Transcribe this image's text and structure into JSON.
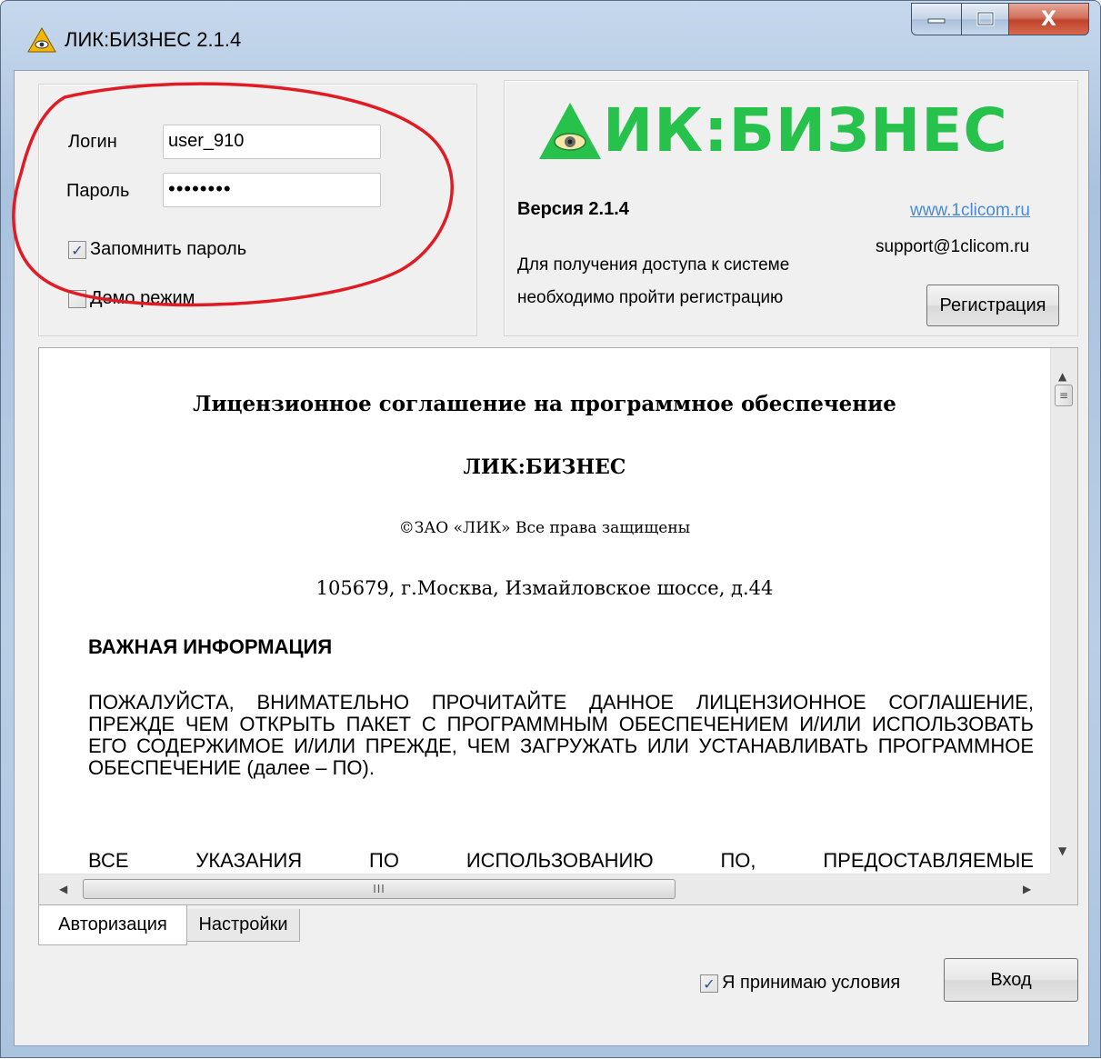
{
  "window": {
    "title": "ЛИК:БИЗНЕС 2.1.4",
    "buttons": {
      "minimize": "–",
      "maximize": "□",
      "close": "X"
    }
  },
  "login": {
    "login_label": "Логин",
    "login_value": "user_910",
    "password_label": "Пароль",
    "password_value": "••••••••",
    "remember_label": "Запомнить пароль",
    "remember_checked": true,
    "demo_label": "Демо режим",
    "demo_checked": false
  },
  "info": {
    "logo_text": "ИК:БИЗНЕС",
    "version": "Версия 2.1.4",
    "website": "www.1clicom.ru",
    "support_email": "support@1clicom.ru",
    "access_line1": "Для получения доступа к системе",
    "access_line2": "необходимо пройти регистрацию",
    "register_button": "Регистрация",
    "logo_color": "#27c24c"
  },
  "license": {
    "title": "Лицензионное соглашение на программное обеспечение",
    "product": "ЛИК:БИЗНЕС",
    "copyright": "©ЗАО «ЛИК» Все права защищены",
    "address": "105679, г.Москва, Измайловское шоссе, д.44",
    "important_heading": "ВАЖНАЯ ИНФОРМАЦИЯ",
    "paragraph1": "ПОЖАЛУЙСТА, ВНИМАТЕЛЬНО ПРОЧИТАЙТЕ ДАННОЕ ЛИЦЕНЗИОННОЕ СОГЛАШЕНИЕ, ПРЕЖДЕ ЧЕМ ОТКРЫТЬ ПАКЕТ С ПРОГРАММНЫМ ОБЕСПЕЧЕНИЕМ И/ИЛИ ИСПОЛЬЗОВАТЬ ЕГО СОДЕРЖИМОЕ И/ИЛИ ПРЕЖДЕ, ЧЕМ ЗАГРУЖАТЬ ИЛИ УСТАНАВЛИВАТЬ ПРОГРАММНОЕ ОБЕСПЕЧЕНИЕ (далее – ПО).",
    "paragraph2_partial": "ВСЕ УКАЗАНИЯ ПО ИСПОЛЬЗОВАНИЮ ПО, ПРЕДОСТАВЛЯЕМЫЕ"
  },
  "tabs": [
    {
      "label": "Авторизация",
      "active": true
    },
    {
      "label": "Настройки",
      "active": false
    }
  ],
  "footer": {
    "accept_label": "Я принимаю условия",
    "accept_checked": true,
    "login_button": "Вход"
  },
  "icons": {
    "checkmark": "✓",
    "scroll_up": "▲",
    "scroll_down": "▼",
    "scroll_left": "◀",
    "scroll_right": "▶",
    "thumb_grip_h": "III",
    "thumb_grip_v": "≡"
  },
  "annotation_color": "#e01b24"
}
